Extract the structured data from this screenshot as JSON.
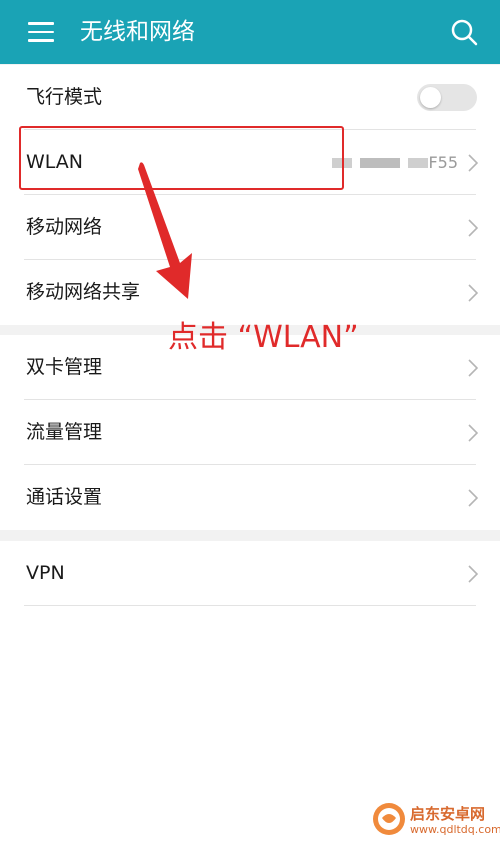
{
  "header": {
    "title": "无线和网络",
    "menu_icon": "menu-icon",
    "search_icon": "search-icon",
    "background": "#1aa3b5"
  },
  "group1": {
    "items": [
      {
        "label": "飞行模式",
        "control": "toggle",
        "toggle_on": false
      },
      {
        "label": "WLAN",
        "value": "F55"
      },
      {
        "label": "移动网络"
      },
      {
        "label": "移动网络共享"
      }
    ]
  },
  "group2": {
    "items": [
      {
        "label": "双卡管理"
      },
      {
        "label": "流量管理"
      },
      {
        "label": "通话设置"
      }
    ]
  },
  "group3": {
    "items": [
      {
        "label": "VPN"
      }
    ]
  },
  "annotation": {
    "text": "点击 “WLAN”",
    "color": "#e02a2a"
  },
  "watermark": {
    "name": "启东安卓网",
    "url": "www.qdltdq.com"
  },
  "colors": {
    "accent": "#1aa3b5",
    "annotation_red": "#e02a2a"
  }
}
